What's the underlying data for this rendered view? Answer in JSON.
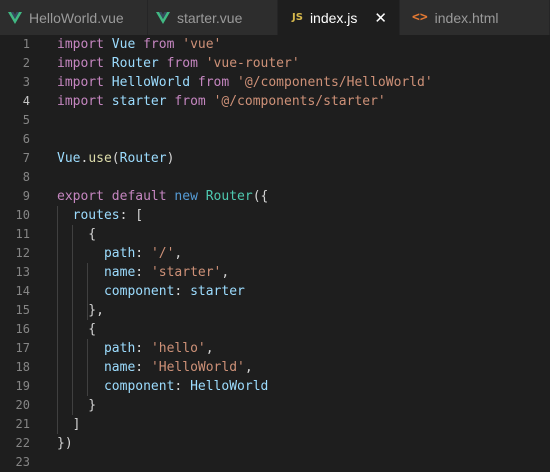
{
  "tabs": [
    {
      "label": "HelloWorld.vue",
      "icon": "vue-icon",
      "active": false
    },
    {
      "label": "starter.vue",
      "icon": "vue-icon",
      "active": false
    },
    {
      "label": "index.js",
      "icon": "js-icon",
      "icon_text": "JS",
      "active": true,
      "close": "✕"
    },
    {
      "label": "index.html",
      "icon": "html-icon",
      "icon_text": "<>",
      "active": false
    }
  ],
  "colors": {
    "vue": "#41b883",
    "js": "#d7b94c",
    "html": "#e37933",
    "keyword": "#c586c0",
    "identifier": "#9cdcfe",
    "string": "#ce9178",
    "function": "#dcdcaa",
    "class": "#4ec9b0"
  },
  "editor": {
    "current_line": 4,
    "lines": [
      {
        "n": "1",
        "t": [
          [
            "import",
            "kw"
          ],
          [
            " ",
            "p"
          ],
          [
            "Vue",
            "id"
          ],
          [
            " ",
            "p"
          ],
          [
            "from",
            "kw"
          ],
          [
            " ",
            "p"
          ],
          [
            "'vue'",
            "str"
          ]
        ]
      },
      {
        "n": "2",
        "t": [
          [
            "import",
            "kw"
          ],
          [
            " ",
            "p"
          ],
          [
            "Router",
            "id"
          ],
          [
            " ",
            "p"
          ],
          [
            "from",
            "kw"
          ],
          [
            " ",
            "p"
          ],
          [
            "'vue-router'",
            "str"
          ]
        ]
      },
      {
        "n": "3",
        "t": [
          [
            "import",
            "kw"
          ],
          [
            " ",
            "p"
          ],
          [
            "HelloWorld",
            "id"
          ],
          [
            " ",
            "p"
          ],
          [
            "from",
            "kw"
          ],
          [
            " ",
            "p"
          ],
          [
            "'@/components/HelloWorld'",
            "str"
          ]
        ]
      },
      {
        "n": "4",
        "t": [
          [
            "import",
            "kw"
          ],
          [
            " ",
            "p"
          ],
          [
            "starter",
            "id"
          ],
          [
            " ",
            "p"
          ],
          [
            "from",
            "kw"
          ],
          [
            " ",
            "p"
          ],
          [
            "'@/components/starter'",
            "str"
          ]
        ]
      },
      {
        "n": "5",
        "t": []
      },
      {
        "n": "6",
        "t": []
      },
      {
        "n": "7",
        "t": [
          [
            "Vue",
            "id"
          ],
          [
            ".",
            "p"
          ],
          [
            "use",
            "fn"
          ],
          [
            "(",
            "p"
          ],
          [
            "Router",
            "id"
          ],
          [
            ")",
            "p"
          ]
        ]
      },
      {
        "n": "8",
        "t": []
      },
      {
        "n": "9",
        "t": [
          [
            "export",
            "kw"
          ],
          [
            " ",
            "p"
          ],
          [
            "default",
            "kw"
          ],
          [
            " ",
            "p"
          ],
          [
            "new",
            "kw2"
          ],
          [
            " ",
            "p"
          ],
          [
            "Router",
            "cls"
          ],
          [
            "({",
            "p"
          ]
        ]
      },
      {
        "n": "10",
        "t": [
          [
            "  ",
            "p"
          ],
          [
            "routes",
            "id"
          ],
          [
            ": [",
            "p"
          ]
        ]
      },
      {
        "n": "11",
        "t": [
          [
            "    {",
            "p"
          ]
        ]
      },
      {
        "n": "12",
        "t": [
          [
            "      ",
            "p"
          ],
          [
            "path",
            "id"
          ],
          [
            ": ",
            "p"
          ],
          [
            "'/'",
            "str"
          ],
          [
            ",",
            "p"
          ]
        ]
      },
      {
        "n": "13",
        "t": [
          [
            "      ",
            "p"
          ],
          [
            "name",
            "id"
          ],
          [
            ": ",
            "p"
          ],
          [
            "'starter'",
            "str"
          ],
          [
            ",",
            "p"
          ]
        ]
      },
      {
        "n": "14",
        "t": [
          [
            "      ",
            "p"
          ],
          [
            "component",
            "id"
          ],
          [
            ": ",
            "p"
          ],
          [
            "starter",
            "id"
          ]
        ]
      },
      {
        "n": "15",
        "t": [
          [
            "    },",
            "p"
          ]
        ]
      },
      {
        "n": "16",
        "t": [
          [
            "    {",
            "p"
          ]
        ]
      },
      {
        "n": "17",
        "t": [
          [
            "      ",
            "p"
          ],
          [
            "path",
            "id"
          ],
          [
            ": ",
            "p"
          ],
          [
            "'hello'",
            "str"
          ],
          [
            ",",
            "p"
          ]
        ]
      },
      {
        "n": "18",
        "t": [
          [
            "      ",
            "p"
          ],
          [
            "name",
            "id"
          ],
          [
            ": ",
            "p"
          ],
          [
            "'HelloWorld'",
            "str"
          ],
          [
            ",",
            "p"
          ]
        ]
      },
      {
        "n": "19",
        "t": [
          [
            "      ",
            "p"
          ],
          [
            "component",
            "id"
          ],
          [
            ": ",
            "p"
          ],
          [
            "HelloWorld",
            "id"
          ]
        ]
      },
      {
        "n": "20",
        "t": [
          [
            "    }",
            "p"
          ]
        ]
      },
      {
        "n": "21",
        "t": [
          [
            "  ]",
            "p"
          ]
        ]
      },
      {
        "n": "22",
        "t": [
          [
            "})",
            "p"
          ]
        ]
      },
      {
        "n": "23",
        "t": []
      }
    ]
  }
}
